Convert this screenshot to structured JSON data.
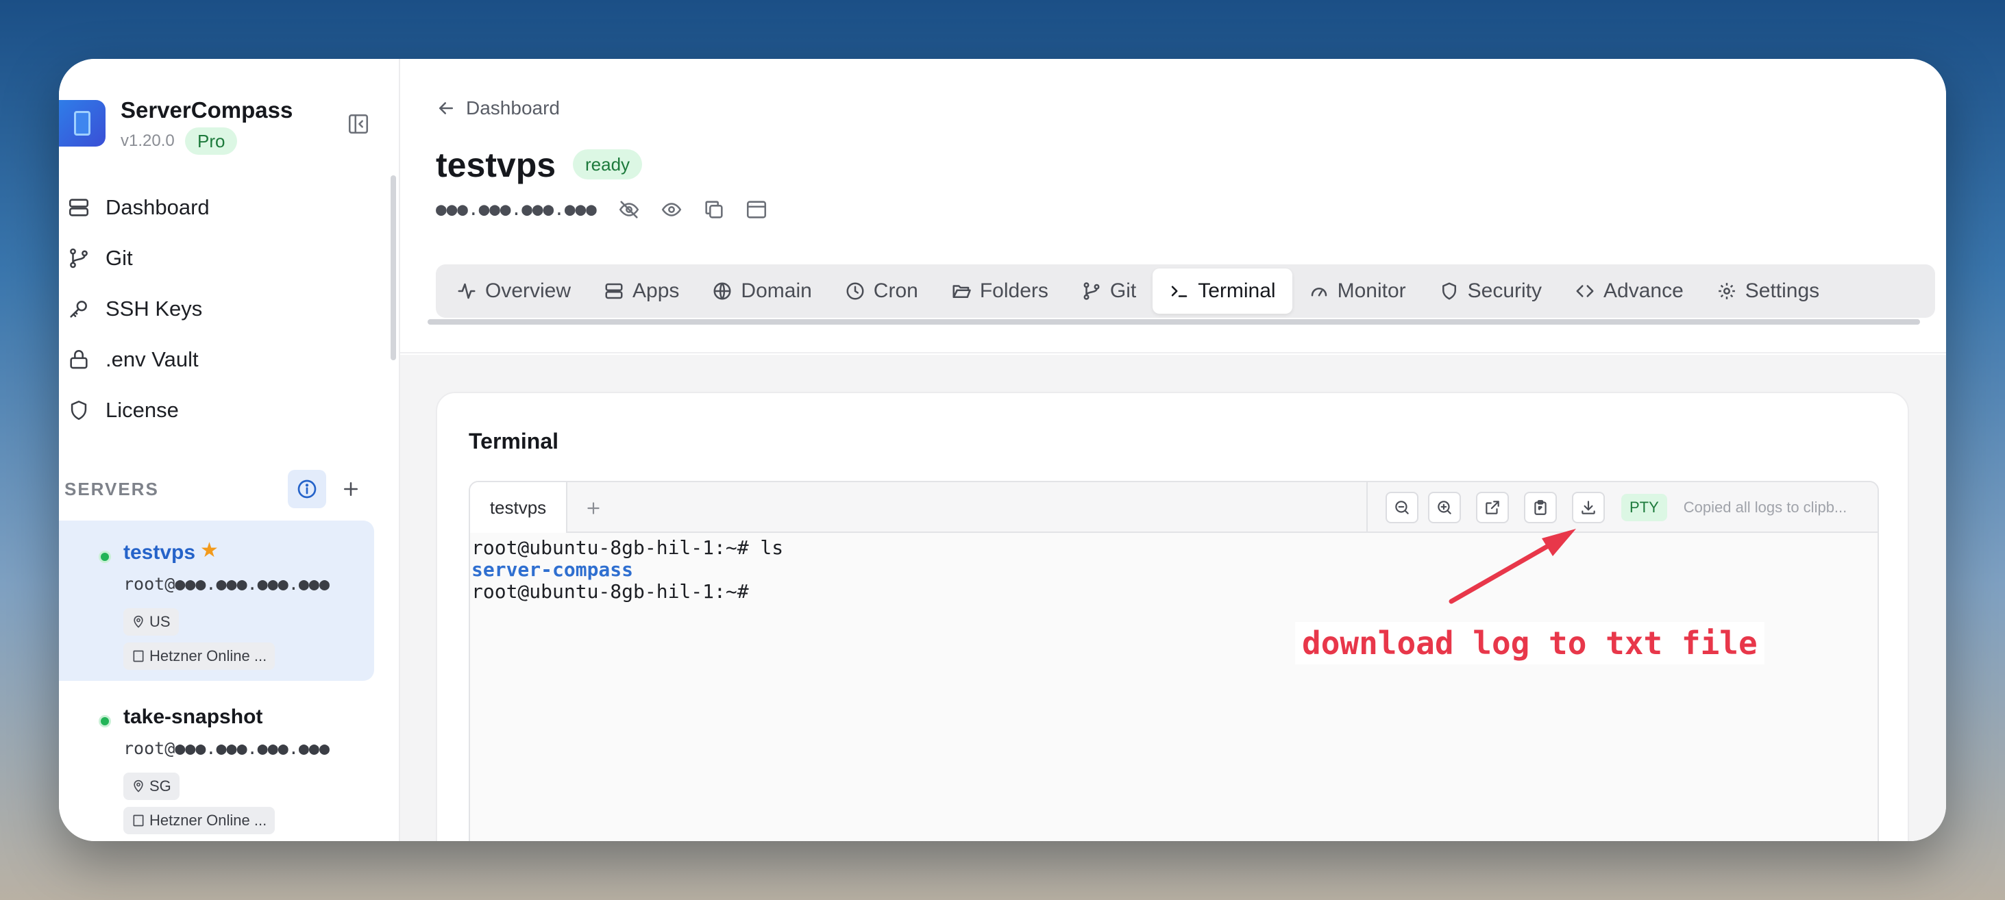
{
  "app": {
    "name": "ServerCompass",
    "version": "v1.20.0",
    "tier": "Pro"
  },
  "sidebar": {
    "nav": [
      {
        "label": "Dashboard",
        "icon": "server-stack-icon"
      },
      {
        "label": "Git",
        "icon": "git-branch-icon"
      },
      {
        "label": "SSH Keys",
        "icon": "key-icon"
      },
      {
        "label": ".env Vault",
        "icon": "lock-icon"
      },
      {
        "label": "License",
        "icon": "shield-icon"
      }
    ],
    "servers_label": "SERVERS",
    "servers": [
      {
        "name": "testvps",
        "starred": true,
        "host": "root@●●●.●●●.●●●.●●●",
        "region": "US",
        "provider": "Hetzner Online ...",
        "status_color": "#22b457"
      },
      {
        "name": "take-snapshot",
        "starred": false,
        "host": "root@●●●.●●●.●●●.●●●",
        "region": "SG",
        "provider": "Hetzner Online ...",
        "status_color": "#22b457"
      }
    ]
  },
  "header": {
    "back_label": "Dashboard",
    "title": "testvps",
    "status": "ready",
    "ip_masked": "●●●.●●●.●●●.●●●"
  },
  "tabs": [
    {
      "label": "Overview",
      "icon": "activity-icon"
    },
    {
      "label": "Apps",
      "icon": "server-icon"
    },
    {
      "label": "Domain",
      "icon": "globe-icon"
    },
    {
      "label": "Cron",
      "icon": "clock-icon"
    },
    {
      "label": "Folders",
      "icon": "folder-open-icon"
    },
    {
      "label": "Git",
      "icon": "git-branch-icon"
    },
    {
      "label": "Terminal",
      "icon": "terminal-icon",
      "active": true
    },
    {
      "label": "Monitor",
      "icon": "gauge-icon"
    },
    {
      "label": "Security",
      "icon": "shield-icon"
    },
    {
      "label": "Advance",
      "icon": "code-icon"
    },
    {
      "label": "Settings",
      "icon": "gear-icon"
    }
  ],
  "terminal": {
    "panel_title": "Terminal",
    "session_tab": "testvps",
    "add_symbol": "+",
    "mode_badge": "PTY",
    "status_text": "Copied all logs to clipb...",
    "lines": [
      {
        "text": "root@ubuntu-8gb-hil-1:~# ls",
        "type": "prompt"
      },
      {
        "text": "server-compass",
        "type": "dir"
      },
      {
        "text": "root@ubuntu-8gb-hil-1:~#",
        "type": "prompt"
      }
    ]
  },
  "annotation": {
    "text": "download log to txt file",
    "color": "#e8374a"
  },
  "colors": {
    "accent": "#2563c9",
    "success": "#22b457",
    "success_bg": "#dcf7e4"
  }
}
